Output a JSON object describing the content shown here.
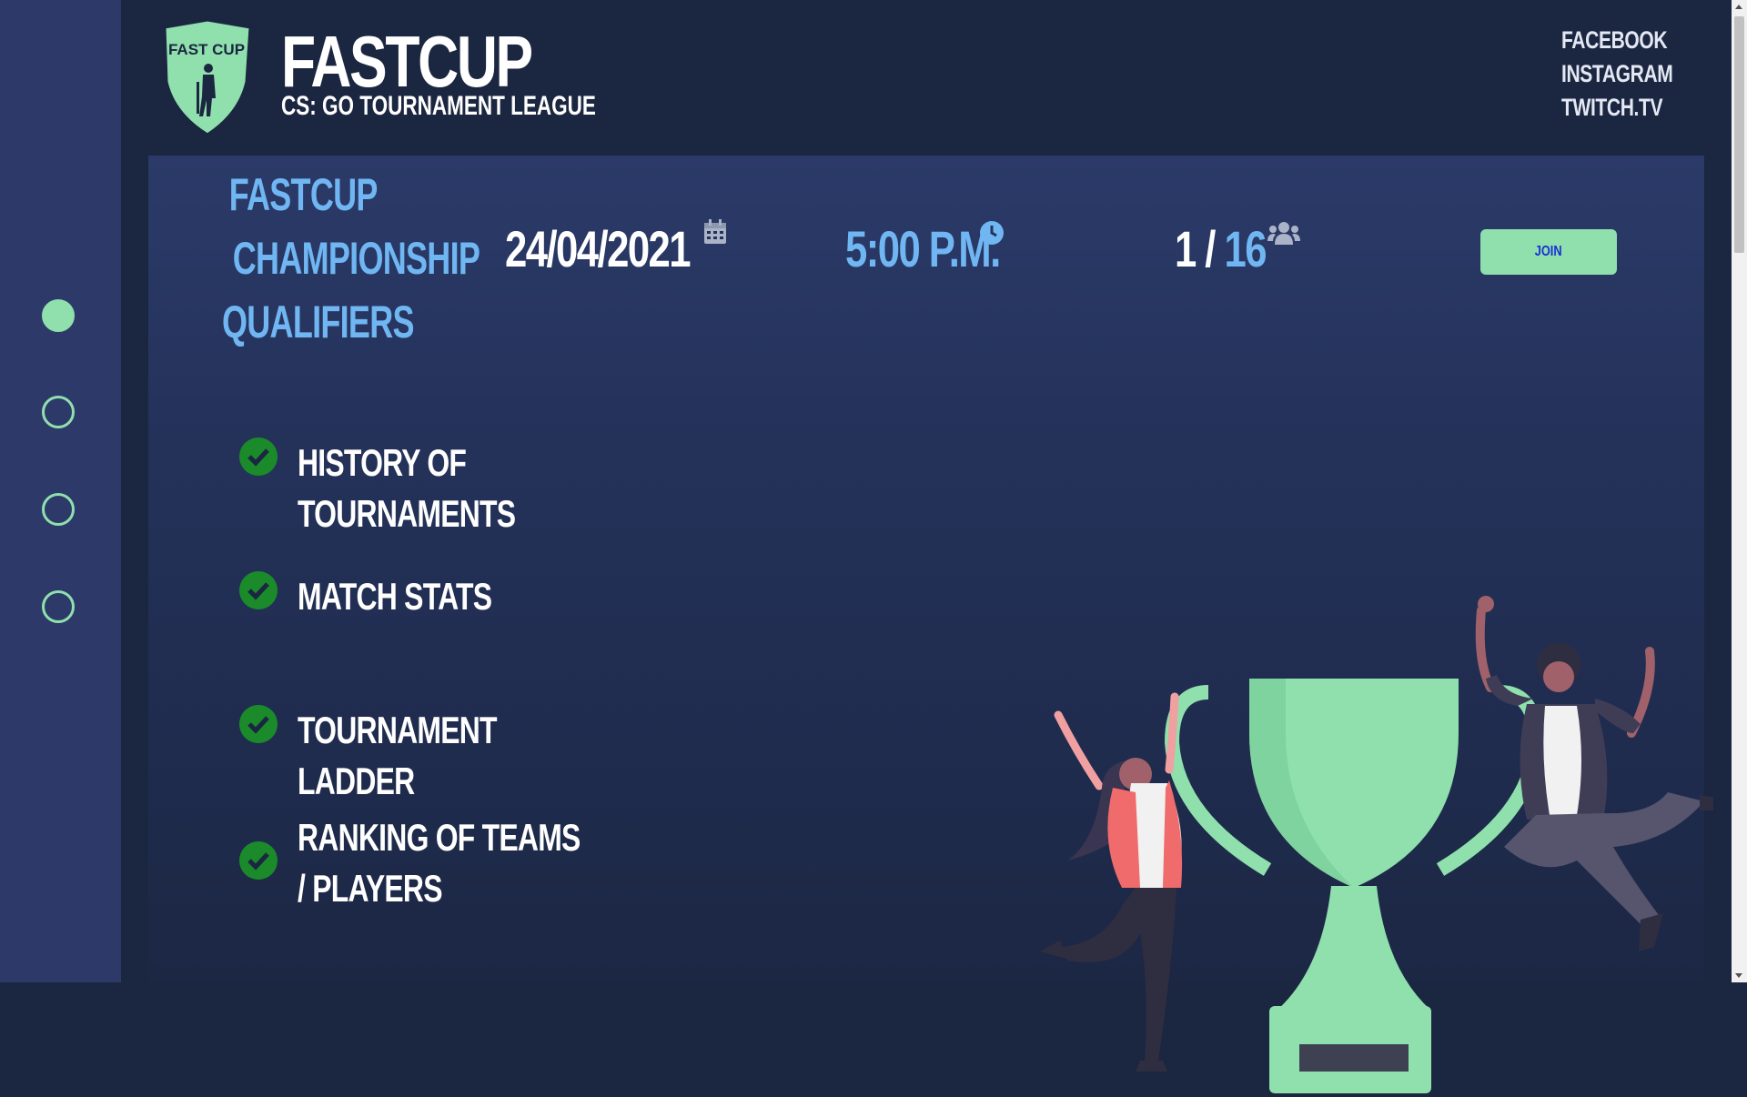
{
  "nav": {
    "active_index": 0,
    "count": 4
  },
  "header": {
    "logo_text": "FAST CUP",
    "title": "FASTCUP",
    "subtitle": "CS: GO TOURNAMENT LEAGUE",
    "social": [
      "FACEBOOK",
      "INSTAGRAM",
      "TWITCH.TV"
    ]
  },
  "tournament": {
    "name_lines": [
      "FASTCUP",
      "CHAMPIONSHIP",
      "QUALIFIERS"
    ],
    "date": "24/04/2021",
    "time": "5:00 P.M.",
    "slots_current": "1 /",
    "slots_max": "16",
    "join_label": "JOIN"
  },
  "features": [
    "HISTORY OF TOURNAMENTS",
    "MATCH STATS",
    "TOURNAMENT LADDER",
    "RANKING OF TEAMS / PLAYERS"
  ],
  "colors": {
    "accent_green": "#8fe0ad",
    "accent_blue": "#6fb6f2",
    "check_green": "#1a8a2a",
    "background": "#1b2640",
    "rail": "#2d3a69"
  },
  "icons": [
    "calendar-icon",
    "clock-icon",
    "users-icon",
    "check-icon"
  ]
}
